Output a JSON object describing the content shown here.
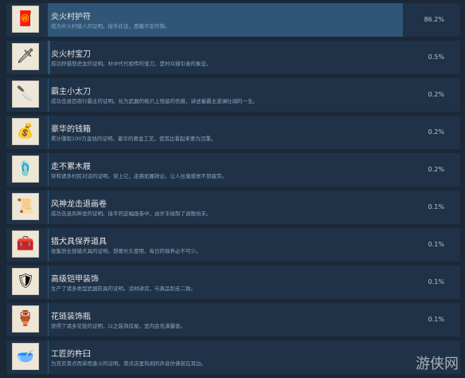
{
  "achievements": [
    {
      "title": "炎火村护符",
      "desc": "成为炎火村猎人的证明。接手此证，愿戴平安符锦。",
      "percent": "86.2%",
      "percent_value": 86.2,
      "icon": "charm-icon"
    },
    {
      "title": "炎火村宝刀",
      "desc": "成功狩猎怒虎龙的证明。村中代代相传的宝刀，是村众猎引者的象征。",
      "percent": "0.5%",
      "percent_value": 0.5,
      "icon": "sword-icon"
    },
    {
      "title": "霸主小太刀",
      "desc": "成功击退百夜行霸主的证明。化为武器的桃爪上残留的伤痕，讲述着霸主波澜壮阔的一生。",
      "percent": "0.2%",
      "percent_value": 0.2,
      "icon": "short-blade-icon"
    },
    {
      "title": "豪华的钱箱",
      "desc": "累计赚取100万金钱的证明。豪华的黄金工艺，使其比看起来要为沉重。",
      "percent": "0.2%",
      "percent_value": 0.2,
      "icon": "treasure-chest-icon"
    },
    {
      "title": "走不累木屐",
      "desc": "穿和请多村民对话的证明。穿上它，走路如履祥云，让人丝毫感觉不到疲劳。",
      "percent": "0.2%",
      "percent_value": 0.2,
      "icon": "wooden-sandal-icon"
    },
    {
      "title": "风神龙击退画卷",
      "desc": "成功击退风神龙的证明。接手的这幅画卷中，由岁丰绘制了退散始末。",
      "percent": "0.1%",
      "percent_value": 0.1,
      "icon": "scroll-icon"
    },
    {
      "title": "猎犬具保养道具",
      "desc": "收集到全部猎犬具的证明。想要长久使用，每日的保养必不可少。",
      "percent": "0.1%",
      "percent_value": 0.1,
      "icon": "tool-kit-icon"
    },
    {
      "title": "高级铠甲装饰",
      "desc": "生产了诸多类型武器防具的证明。话材讲究，与真品别无二致。",
      "percent": "0.1%",
      "percent_value": 0.1,
      "icon": "armor-icon"
    },
    {
      "title": "花链装饰瓶",
      "desc": "获得了诸多花链的证明，以之装饰房屋，室内会充满馨香。",
      "percent": "0.1%",
      "percent_value": 0.1,
      "icon": "vase-icon"
    },
    {
      "title": "工匠的杵臼",
      "desc": "为充实菜点而单而查斗的证明。菜点店里热闹的声音仿佛就在耳边。",
      "percent": "",
      "percent_value": 0.1,
      "icon": "mortar-icon"
    }
  ],
  "watermark": "游侠网"
}
